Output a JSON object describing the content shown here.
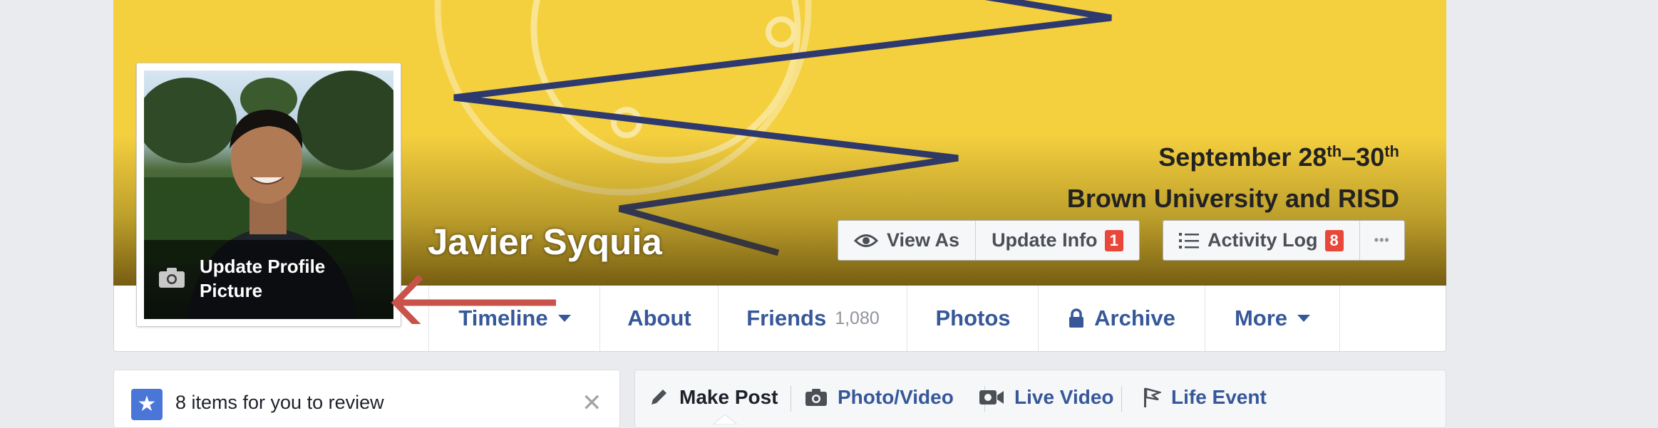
{
  "cover": {
    "dates_main": "September 28",
    "dates_sup1": "th",
    "dates_mid": "–30",
    "dates_sup2": "th",
    "location": "Brown University and RISD",
    "colors": {
      "background": "#f4cf3e",
      "navy": "#2e3a6e",
      "ring": "#f9e7a0"
    }
  },
  "profile": {
    "name": "Javier Syquia",
    "update_picture_label": "Update Profile Picture",
    "icon": "camera-icon"
  },
  "cover_buttons": {
    "view_as": "View As",
    "update_info": "Update Info",
    "update_info_badge": "1",
    "activity_log": "Activity Log",
    "activity_log_badge": "8",
    "more_dots": "•••"
  },
  "nav": {
    "timeline": "Timeline",
    "about": "About",
    "friends": "Friends",
    "friends_count": "1,080",
    "photos": "Photos",
    "archive": "Archive",
    "more": "More"
  },
  "review": {
    "icon": "star-icon",
    "text": "8 items for you to review",
    "close": "✕"
  },
  "composer": {
    "make_post": "Make Post",
    "photo_video": "Photo/Video",
    "live_video": "Live Video",
    "life_event": "Life Event"
  }
}
